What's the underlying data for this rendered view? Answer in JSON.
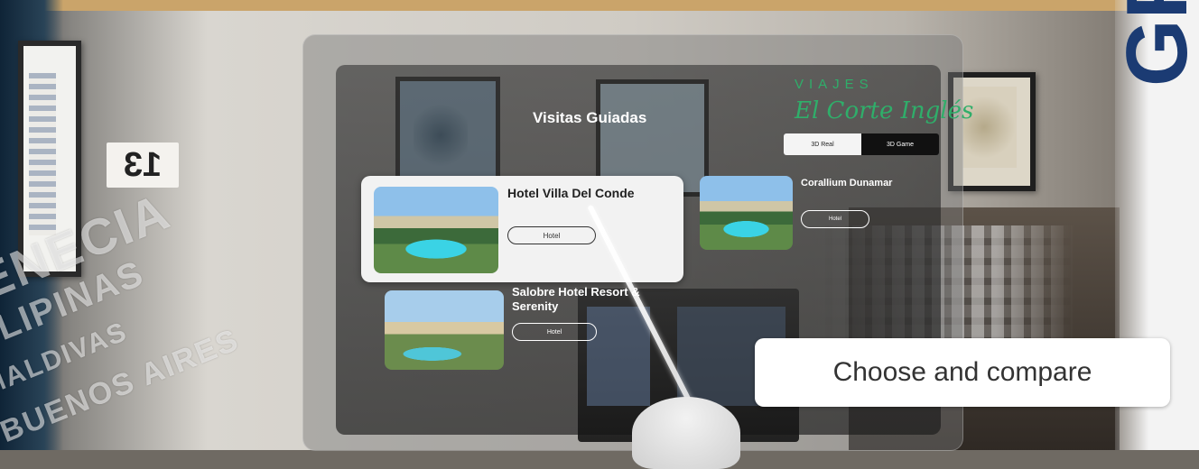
{
  "panel": {
    "title": "Visitas Guiadas",
    "brand_top": "VIAJES",
    "brand_bottom": "El Corte Inglés",
    "toggle": {
      "options": [
        "3D Real",
        "3D Game"
      ],
      "selected": "3D Real"
    }
  },
  "hotels": [
    {
      "name": "Hotel Villa Del Conde",
      "button": "Hotel",
      "focused": true
    },
    {
      "name": "Corallium Dunamar",
      "button": "Hotel",
      "focused": false
    },
    {
      "name": "Salobre Hotel Resort & Serenity",
      "button": "Hotel",
      "focused": false
    }
  ],
  "room": {
    "wall_number": "13",
    "brand_letters": "GR",
    "glass_lettering": [
      "VENECIA",
      "FILIPINAS",
      "MALDIVAS",
      "BUENOS AIRES"
    ]
  },
  "caption": "Choose and compare",
  "icons": [
    "vr-controller-pointer-icon"
  ]
}
